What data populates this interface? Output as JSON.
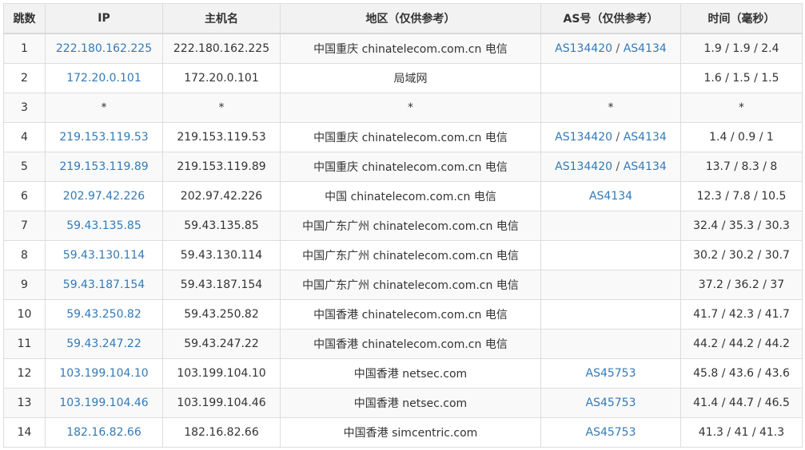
{
  "colors": {
    "link": "#337ab7",
    "text": "#333333",
    "header_bg": "#f2f2f2",
    "border": "#dddddd"
  },
  "columns": [
    "跳数",
    "IP",
    "主机名",
    "地区（仅供参考）",
    "AS号（仅供参考）",
    "时间（毫秒）"
  ],
  "rows": [
    {
      "hop": "1",
      "ip": "222.180.162.225",
      "host": "222.180.162.225",
      "region": "中国重庆 chinatelecom.com.cn 电信",
      "as": [
        "AS134420",
        "AS4134"
      ],
      "time": "1.9 / 1.9 / 2.4"
    },
    {
      "hop": "2",
      "ip": "172.20.0.101",
      "host": "172.20.0.101",
      "region": "局域网",
      "as": [],
      "time": "1.6 / 1.5 / 1.5"
    },
    {
      "hop": "3",
      "ip": "*",
      "host": "*",
      "region": "*",
      "as_text": "*",
      "as": [],
      "time": "*"
    },
    {
      "hop": "4",
      "ip": "219.153.119.53",
      "host": "219.153.119.53",
      "region": "中国重庆 chinatelecom.com.cn 电信",
      "as": [
        "AS134420",
        "AS4134"
      ],
      "time": "1.4 / 0.9 / 1"
    },
    {
      "hop": "5",
      "ip": "219.153.119.89",
      "host": "219.153.119.89",
      "region": "中国重庆 chinatelecom.com.cn 电信",
      "as": [
        "AS134420",
        "AS4134"
      ],
      "time": "13.7 / 8.3 / 8"
    },
    {
      "hop": "6",
      "ip": "202.97.42.226",
      "host": "202.97.42.226",
      "region": "中国 chinatelecom.com.cn 电信",
      "as": [
        "AS4134"
      ],
      "time": "12.3 / 7.8 / 10.5"
    },
    {
      "hop": "7",
      "ip": "59.43.135.85",
      "host": "59.43.135.85",
      "region": "中国广东广州 chinatelecom.com.cn 电信",
      "as": [],
      "time": "32.4 / 35.3 / 30.3"
    },
    {
      "hop": "8",
      "ip": "59.43.130.114",
      "host": "59.43.130.114",
      "region": "中国广东广州 chinatelecom.com.cn 电信",
      "as": [],
      "time": "30.2 / 30.2 / 30.7"
    },
    {
      "hop": "9",
      "ip": "59.43.187.154",
      "host": "59.43.187.154",
      "region": "中国广东广州 chinatelecom.com.cn 电信",
      "as": [],
      "time": "37.2 / 36.2 / 37"
    },
    {
      "hop": "10",
      "ip": "59.43.250.82",
      "host": "59.43.250.82",
      "region": "中国香港 chinatelecom.com.cn 电信",
      "as": [],
      "time": "41.7 / 42.3 / 41.7"
    },
    {
      "hop": "11",
      "ip": "59.43.247.22",
      "host": "59.43.247.22",
      "region": "中国香港 chinatelecom.com.cn 电信",
      "as": [],
      "time": "44.2 / 44.2 / 44.2"
    },
    {
      "hop": "12",
      "ip": "103.199.104.10",
      "host": "103.199.104.10",
      "region": "中国香港 netsec.com",
      "as": [
        "AS45753"
      ],
      "time": "45.8 / 43.6 / 43.6"
    },
    {
      "hop": "13",
      "ip": "103.199.104.46",
      "host": "103.199.104.46",
      "region": "中国香港 netsec.com",
      "as": [
        "AS45753"
      ],
      "time": "41.4 / 44.7 / 46.5"
    },
    {
      "hop": "14",
      "ip": "182.16.82.66",
      "host": "182.16.82.66",
      "region": "中国香港 simcentric.com",
      "as": [
        "AS45753"
      ],
      "time": "41.3 / 41 / 41.3"
    }
  ]
}
